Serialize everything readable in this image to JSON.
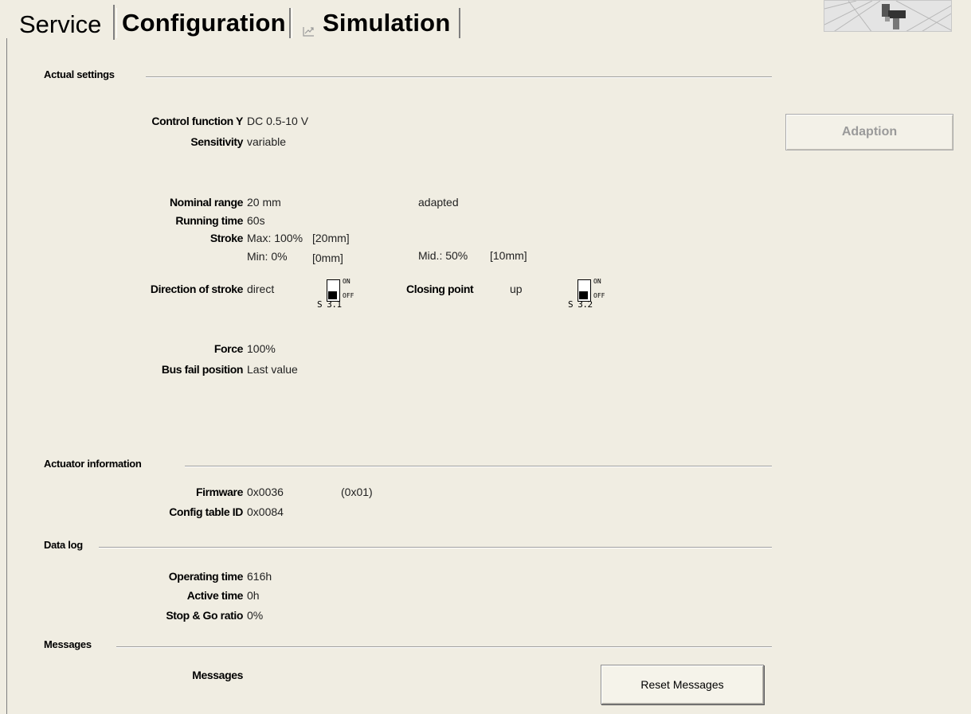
{
  "tabs": [
    {
      "label": "Service"
    },
    {
      "label": "Configuration"
    },
    {
      "label": "Simulation",
      "icon": "simulation-icon"
    }
  ],
  "sections": {
    "actual_settings": "Actual settings",
    "actuator_information": "Actuator information",
    "data_log": "Data log",
    "messages": "Messages"
  },
  "actual": {
    "control_function_label": "Control function Y",
    "control_function_value": "DC 0.5-10 V",
    "sensitivity_label": "Sensitivity",
    "sensitivity_value": "variable",
    "nominal_range_label": "Nominal range",
    "nominal_range_value": "20 mm",
    "nominal_range_status": "adapted",
    "running_time_label": "Running time",
    "running_time_value": "60s",
    "stroke_label": "Stroke",
    "stroke_max": "Max: 100%",
    "stroke_max_mm": "[20mm]",
    "stroke_min": "Min: 0%",
    "stroke_min_mm": "[0mm]",
    "stroke_mid": "Mid.: 50%",
    "stroke_mid_mm": "[10mm]",
    "direction_label": "Direction of stroke",
    "direction_value": "direct",
    "closing_point_label": "Closing point",
    "closing_point_value": "up",
    "force_label": "Force",
    "force_value": "100%",
    "bus_fail_label": "Bus fail position",
    "bus_fail_value": "Last value"
  },
  "switches": [
    {
      "on": "ON",
      "off": "OFF",
      "id": "S 3.1",
      "state": "OFF"
    },
    {
      "on": "ON",
      "off": "OFF",
      "id": "S 3.2",
      "state": "OFF"
    }
  ],
  "actuator": {
    "firmware_label": "Firmware",
    "firmware_value": "0x0036",
    "firmware_sub": "(0x01)",
    "config_label": "Config table ID",
    "config_value": "0x0084"
  },
  "datalog": {
    "operating_label": "Operating time",
    "operating_value": "616h",
    "active_label": "Active time",
    "active_value": "0h",
    "stopgo_label": "Stop & Go ratio",
    "stopgo_value": "0%"
  },
  "messages": {
    "label": "Messages"
  },
  "buttons": {
    "adaption": "Adaption",
    "reset_messages": "Reset Messages"
  }
}
